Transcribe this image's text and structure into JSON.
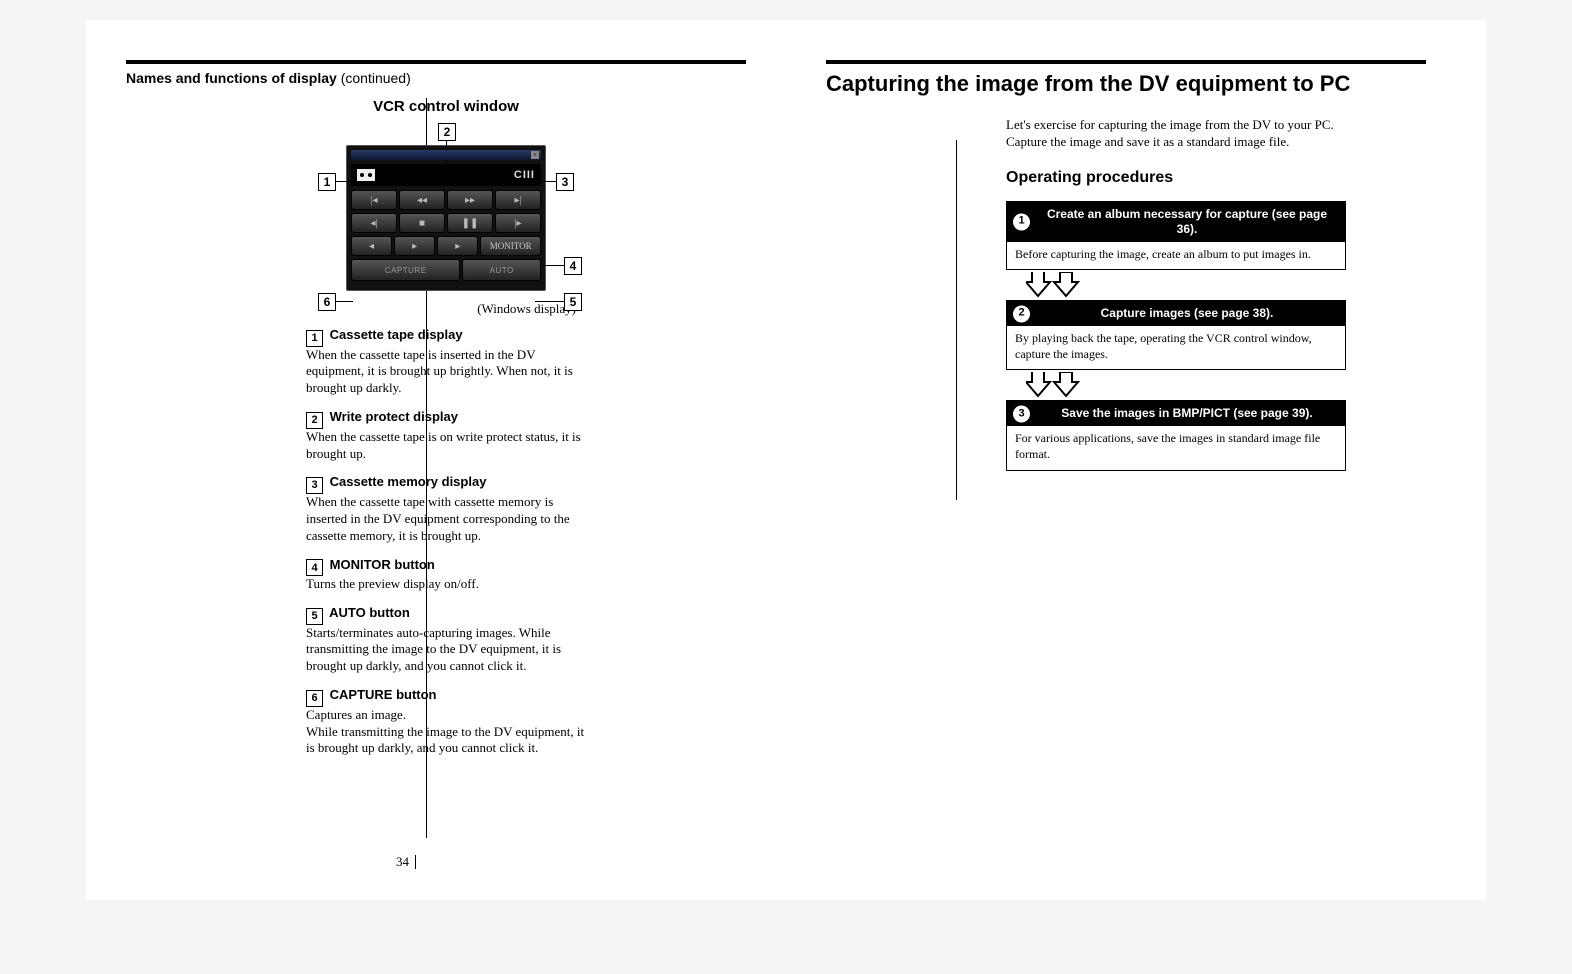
{
  "left": {
    "title_main": "Names and functions of display",
    "title_cont": " (continued)",
    "sub_title": "VCR control window",
    "caption": "(Windows display)",
    "vcr": {
      "mem_label": "CIII",
      "capture_label": "CAPTURE",
      "auto_label": "AUTO",
      "monitor_label": "MONITOR"
    },
    "callouts": {
      "n1": "1",
      "n2": "2",
      "n3": "3",
      "n4": "4",
      "n5": "5",
      "n6": "6"
    },
    "items": [
      {
        "num": "1",
        "title": "Cassette tape display",
        "body": "When the cassette tape is inserted in the DV equipment, it is brought up brightly. When not, it is brought up darkly."
      },
      {
        "num": "2",
        "title": "Write protect display",
        "body": "When the cassette tape is on write protect status, it is brought up."
      },
      {
        "num": "3",
        "title": "Cassette memory display",
        "body": "When the cassette tape with cassette memory is inserted in the DV equipment corresponding to the cassette memory, it is brought up."
      },
      {
        "num": "4",
        "title": "MONITOR button",
        "body": "Turns the preview display on/off."
      },
      {
        "num": "5",
        "title": "AUTO button",
        "body": "Starts/terminates auto-capturing images. While transmitting the image to the DV equipment, it is brought up darkly, and you cannot click it."
      },
      {
        "num": "6",
        "title": "CAPTURE button",
        "body": "Captures an image.\nWhile transmitting the image to the DV equipment, it is brought up darkly, and you cannot click it."
      }
    ],
    "page_number": "34"
  },
  "right": {
    "big_title": "Capturing the image from the DV equipment to PC",
    "intro": "Let's exercise for capturing the image from the DV to your PC. Capture the image and save it as a standard image file.",
    "op_title": "Operating procedures",
    "steps": [
      {
        "num": "1",
        "head": "Create an album necessary for capture (see page 36).",
        "body": "Before capturing the image, create an album to put images in."
      },
      {
        "num": "2",
        "head": "Capture images (see page 38).",
        "body": "By playing back the tape, operating the VCR control window, capture the images."
      },
      {
        "num": "3",
        "head": "Save the images in BMP/PICT (see page 39).",
        "body": "For various applications, save the images in standard image file format."
      }
    ]
  }
}
